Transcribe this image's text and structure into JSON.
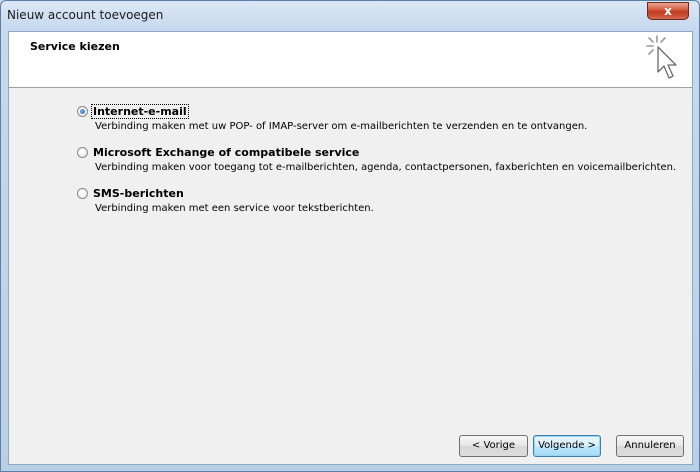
{
  "window": {
    "title": "Nieuw account toevoegen",
    "close_label": "x"
  },
  "header": {
    "title": "Service kiezen"
  },
  "options": [
    {
      "label": "Internet-e-mail",
      "description": "Verbinding maken met uw POP- of IMAP-server om e-mailberichten te verzenden en te ontvangen.",
      "selected": true
    },
    {
      "label": "Microsoft Exchange of compatibele service",
      "description": "Verbinding maken voor toegang tot e-mailberichten, agenda, contactpersonen, faxberichten en voicemailberichten.",
      "selected": false
    },
    {
      "label": "SMS-berichten",
      "description": "Verbinding maken met een service voor tekstberichten.",
      "selected": false
    }
  ],
  "buttons": {
    "back": "< Vorige",
    "next": "Volgende >",
    "cancel": "Annuleren"
  },
  "colors": {
    "titlebar": "#c7d9ee",
    "close_button": "#c0391f",
    "dialog_bg": "#f0f0f0",
    "header_bg": "#ffffff",
    "radio_selected": "#1f5ea8",
    "default_button_border": "#3c7fb1"
  },
  "icons": {
    "wizard": "cursor-click-icon"
  }
}
